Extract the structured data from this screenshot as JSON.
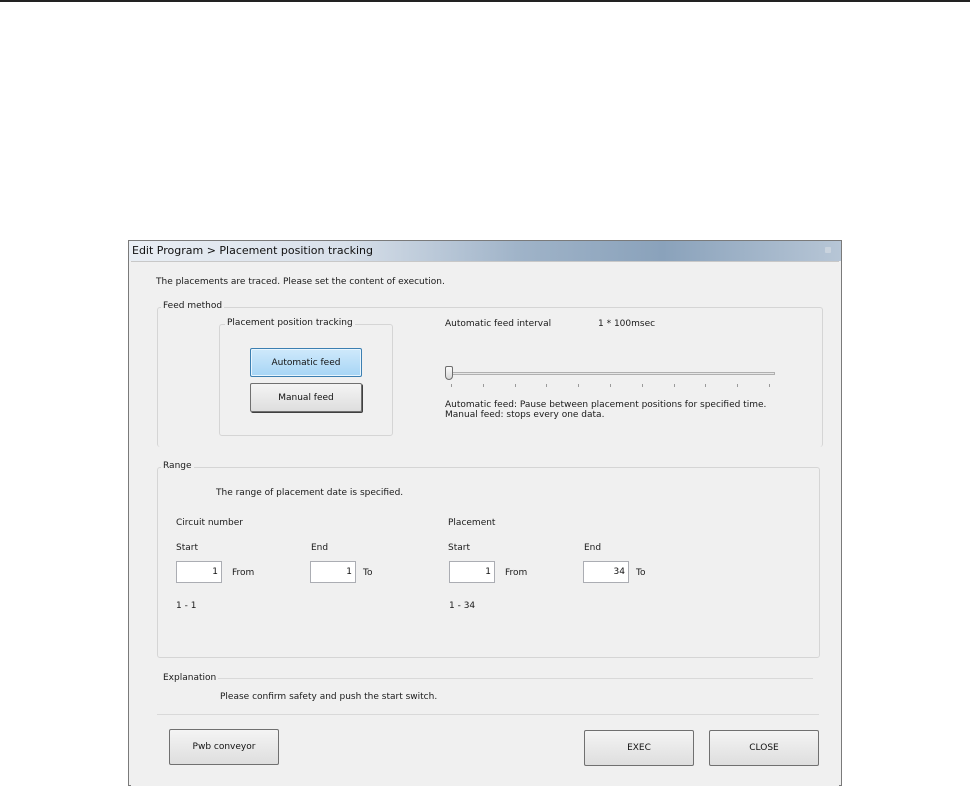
{
  "window": {
    "title": "Edit Program > Placement position tracking"
  },
  "intro": "The placements are traced. Please set the content of execution.",
  "feed_method": {
    "legend": "Feed method",
    "tracking_group": "Placement position tracking",
    "automatic_button": "Automatic feed",
    "manual_button": "Manual feed",
    "selected": "Automatic feed",
    "interval_label": "Automatic feed interval",
    "interval_value": "1 * 100msec",
    "slider": {
      "value": 1,
      "min": 1,
      "max": 11
    },
    "help_line1": "Automatic feed: Pause between placement positions for specified time.",
    "help_line2": "Manual feed: stops every one data."
  },
  "range": {
    "legend": "Range",
    "description": "The range of placement date is specified.",
    "circuit": {
      "label": "Circuit number",
      "start_label": "Start",
      "end_label": "End",
      "start_value": "1",
      "end_value": "1",
      "from_label": "From",
      "to_label": "To",
      "range_text": "1 - 1"
    },
    "placement": {
      "label": "Placement",
      "start_label": "Start",
      "end_label": "End",
      "start_value": "1",
      "end_value": "34",
      "from_label": "From",
      "to_label": "To",
      "range_text": "1 - 34"
    }
  },
  "explanation": {
    "legend": "Explanation",
    "text": "Please confirm safety and push the start switch."
  },
  "buttons": {
    "pwb": "Pwb conveyor",
    "exec": "EXEC",
    "close": "CLOSE"
  }
}
